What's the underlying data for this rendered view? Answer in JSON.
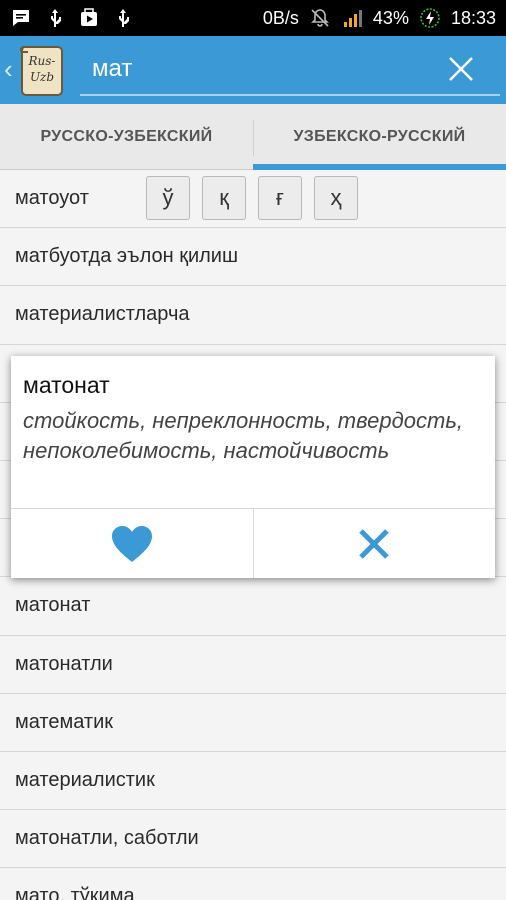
{
  "status_bar": {
    "network_speed": "0B/s",
    "battery": "43%",
    "time": "18:33"
  },
  "app": {
    "logo_text_top": "Rus-",
    "logo_text_bottom": "Uzb",
    "search_value": "мат",
    "accent_color": "#3b9ad6"
  },
  "tabs": [
    {
      "label": "РУССКО-УЗБЕКСКИЙ",
      "active": false
    },
    {
      "label": "УЗБЕКСКО-РУССКИЙ",
      "active": true
    }
  ],
  "letters": [
    "ў",
    "қ",
    "ғ",
    "ҳ"
  ],
  "list": [
    "матоуот",
    "матбуотда эълон қилиш",
    "материалистларча",
    "",
    "",
    "",
    "",
    "матонат",
    "матонатли",
    "математик",
    "материалистик",
    "матонатли, саботли",
    "мато, тўқима"
  ],
  "dialog": {
    "word": "матонат",
    "translation": "стойкость, непреклонность, твердость, непоколебимость, настойчивость",
    "favorite_icon": "heart-icon",
    "close_icon": "close-icon"
  }
}
